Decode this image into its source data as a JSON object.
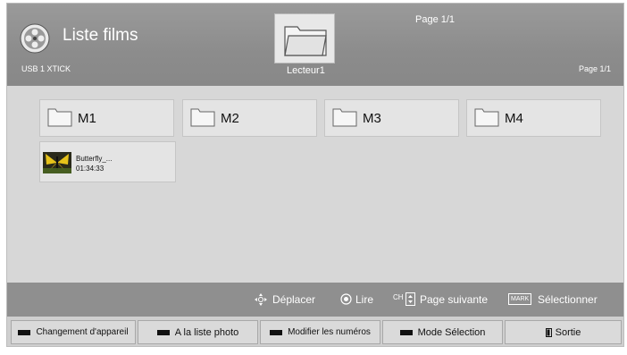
{
  "header": {
    "title": "Liste films",
    "device": "USB 1 XTICK",
    "drive_label": "Lecteur1",
    "page_top": "Page 1/1",
    "page_right": "Page 1/1"
  },
  "folders": [
    {
      "label": "M1"
    },
    {
      "label": "M2"
    },
    {
      "label": "M3"
    },
    {
      "label": "M4"
    }
  ],
  "file": {
    "name": "Butterfly_...",
    "duration": "01:34:33"
  },
  "hints": {
    "move": "Déplacer",
    "play": "Lire",
    "ch": "CH",
    "next_page": "Page suivante",
    "mark": "MARK",
    "select": "Sélectionner"
  },
  "buttons": {
    "change_device": "Changement d'appareil",
    "photo_list": "A la liste photo",
    "modify_numbers": "Modifier les numéros",
    "select_mode": "Mode Sélection",
    "exit": "Sortie"
  }
}
